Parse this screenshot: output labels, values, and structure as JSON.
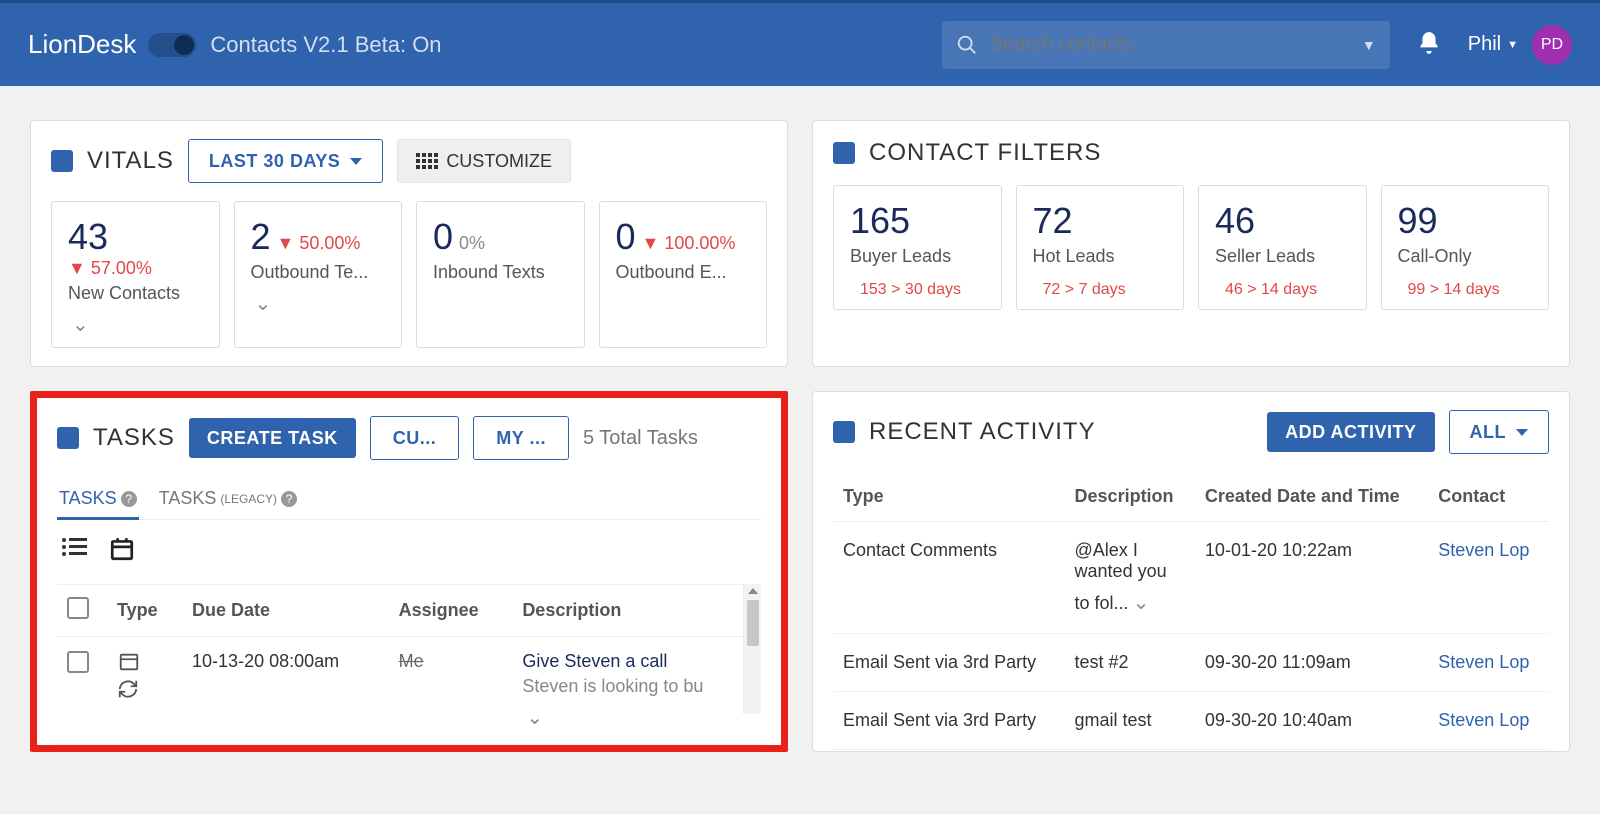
{
  "header": {
    "brand": "LionDesk",
    "beta_label": "Contacts V2.1 Beta: On",
    "search_placeholder": "Search contacts",
    "user_name": "Phil",
    "user_initials": "PD"
  },
  "vitals": {
    "title": "VITALS",
    "range": "LAST 30 DAYS",
    "customize": "CUSTOMIZE",
    "stats": [
      {
        "value": "43",
        "delta": "57.00%",
        "dir": "down",
        "label": "New Contacts"
      },
      {
        "value": "2",
        "delta": "50.00%",
        "dir": "down",
        "label": "Outbound Te..."
      },
      {
        "value": "0",
        "delta": "0%",
        "dir": "none",
        "label": "Inbound Texts"
      },
      {
        "value": "0",
        "delta": "100.00%",
        "dir": "down",
        "label": "Outbound E..."
      }
    ]
  },
  "filters": {
    "title": "CONTACT FILTERS",
    "items": [
      {
        "value": "165",
        "label": "Buyer Leads",
        "sub": "153 > 30 days"
      },
      {
        "value": "72",
        "label": "Hot Leads",
        "sub": "72 > 7 days"
      },
      {
        "value": "46",
        "label": "Seller Leads",
        "sub": "46 > 14 days"
      },
      {
        "value": "99",
        "label": "Call-Only",
        "sub": "99 > 14 days"
      }
    ]
  },
  "tasks": {
    "title": "TASKS",
    "create": "CREATE TASK",
    "btn2": "CU...",
    "btn3": "MY ...",
    "total": "5 Total Tasks",
    "tab1": "TASKS",
    "tab2a": "TASKS",
    "tab2b": "(LEGACY)",
    "cols": {
      "type": "Type",
      "due": "Due Date",
      "assignee": "Assignee",
      "desc": "Description"
    },
    "rows": [
      {
        "due": "10-13-20 08:00am",
        "assignee": "Me",
        "desc1": "Give Steven a call",
        "desc2": "Steven is looking to bu"
      }
    ]
  },
  "activity": {
    "title": "RECENT ACTIVITY",
    "add": "ADD ACTIVITY",
    "all": "ALL",
    "cols": {
      "type": "Type",
      "desc": "Description",
      "date": "Created Date and Time",
      "contact": "Contact"
    },
    "rows": [
      {
        "type": "Contact Comments",
        "desc": "@Alex I wanted you to fol...",
        "date": "10-01-20 10:22am",
        "contact": "Steven Lop"
      },
      {
        "type": "Email Sent via 3rd Party",
        "desc": "test #2",
        "date": "09-30-20 11:09am",
        "contact": "Steven Lop"
      },
      {
        "type": "Email Sent via 3rd Party",
        "desc": "gmail test",
        "date": "09-30-20 10:40am",
        "contact": "Steven Lop"
      }
    ]
  }
}
